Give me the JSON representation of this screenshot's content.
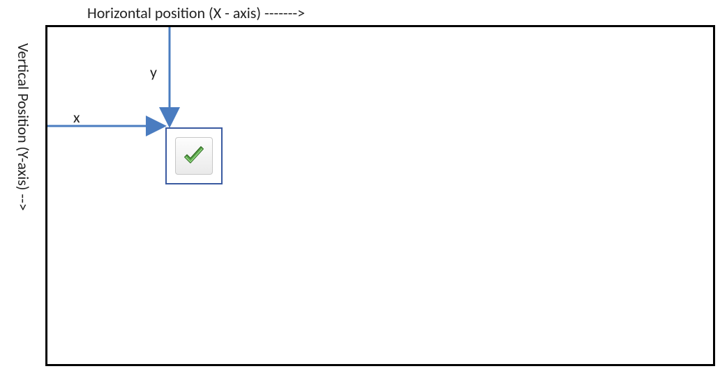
{
  "labels": {
    "horizontal": "Horizontal position (X - axis) ------->",
    "vertical": "Vertical Position (Y-axis)   -->",
    "x": "x",
    "y": "y"
  },
  "colors": {
    "arrow": "#4a7cc0",
    "box_border": "#3a5aa0",
    "check": "#5aa24a",
    "check_shadow": "#2f6a22"
  },
  "icons": {
    "check": "checkmark-icon"
  }
}
